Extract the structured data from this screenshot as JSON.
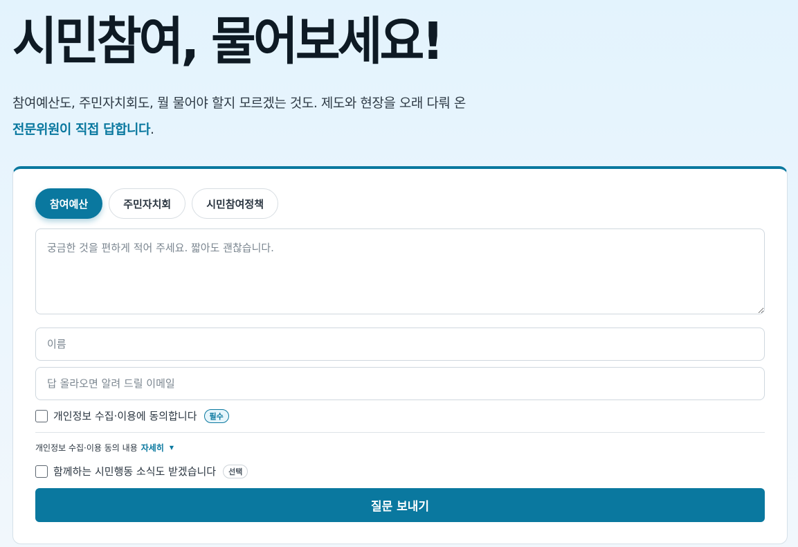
{
  "hero": {
    "title": "시민참여, 물어보세요!",
    "description_line1": "참여예산도, 주민자치회도, 뭘 물어야 할지 모르겠는 것도. 제도와 현장을 오래 다뤄 온",
    "description_emphasis": "전문위원이 직접 답합니다",
    "description_period": "."
  },
  "form": {
    "tabs": [
      {
        "label": "참여예산",
        "active": true
      },
      {
        "label": "주민자치회",
        "active": false
      },
      {
        "label": "시민참여정책",
        "active": false
      }
    ],
    "question": {
      "placeholder": "궁금한 것을 편하게 적어 주세요. 짧아도 괜찮습니다.",
      "value": ""
    },
    "name": {
      "placeholder": "이름",
      "value": ""
    },
    "email": {
      "placeholder": "답 올라오면 알려 드릴 이메일",
      "value": ""
    },
    "consent": {
      "label": "개인정보 수집·이용에 동의합니다",
      "badge": "필수",
      "checked": false
    },
    "privacy": {
      "text": "개인정보 수집·이용 동의 내용",
      "detail_label": "자세히",
      "caret": "▼"
    },
    "newsletter": {
      "label": "함께하는 시민행동 소식도 받겠습니다",
      "badge": "선택",
      "checked": false
    },
    "submit_label": "질문 보내기"
  },
  "colors": {
    "accent": "#0a789f",
    "title": "#0e1a24",
    "background": "#e3f3fd"
  }
}
